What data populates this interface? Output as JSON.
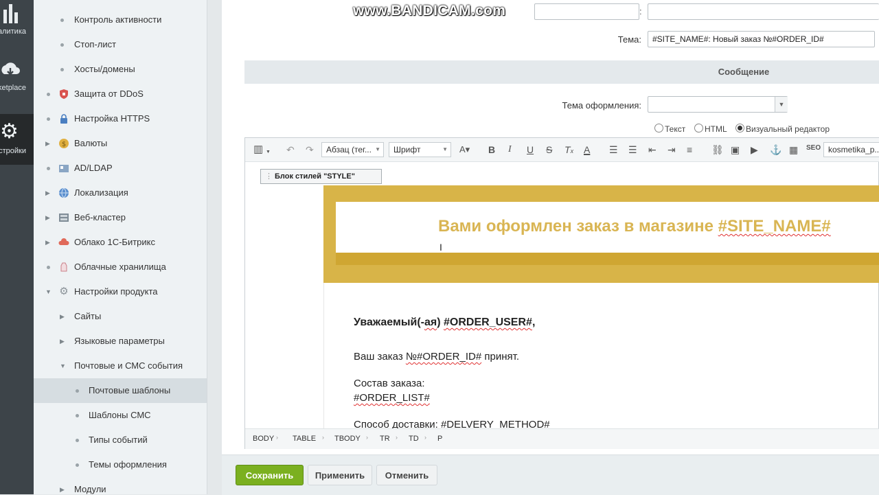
{
  "watermark": "www.BANDICAM.com",
  "rail": {
    "items": [
      {
        "icon": "analytics-icon",
        "label": "алитика"
      },
      {
        "icon": "marketplace-icon",
        "label": "ketplace"
      },
      {
        "icon": "settings-icon",
        "label": "стройки"
      }
    ]
  },
  "menu": {
    "items": [
      {
        "label": "Контроль активности",
        "level": 2
      },
      {
        "label": "Стоп-лист",
        "level": 2
      },
      {
        "label": "Хосты/домены",
        "level": 2
      },
      {
        "label": "Защита от DDoS",
        "level": 1,
        "icon": "ddos-shield-icon"
      },
      {
        "label": "Настройка HTTPS",
        "level": 1,
        "icon": "https-lock-icon"
      },
      {
        "label": "Валюты",
        "level": 1,
        "icon": "currency-icon"
      },
      {
        "label": "AD/LDAP",
        "level": 1,
        "icon": "ldap-icon"
      },
      {
        "label": "Локализация",
        "level": 1,
        "icon": "globe-icon"
      },
      {
        "label": "Веб-кластер",
        "level": 1,
        "icon": "cluster-icon"
      },
      {
        "label": "Облако 1С-Битрикс",
        "level": 1,
        "icon": "cloud-icon"
      },
      {
        "label": "Облачные хранилища",
        "level": 1,
        "icon": "storage-icon"
      },
      {
        "label": "Настройки продукта",
        "level": 1,
        "icon": "gear-icon"
      },
      {
        "label": "Сайты",
        "level": 2
      },
      {
        "label": "Языковые параметры",
        "level": 2
      },
      {
        "label": "Почтовые и СМС события",
        "level": 2
      },
      {
        "label": "Почтовые шаблоны",
        "level": 3
      },
      {
        "label": "Шаблоны СМС",
        "level": 3
      },
      {
        "label": "Типы событий",
        "level": 3
      },
      {
        "label": "Темы оформления",
        "level": 3
      },
      {
        "label": "Модули",
        "level": 2
      }
    ]
  },
  "form": {
    "colon": ":",
    "subject_label": "Тема:",
    "subject_value": "#SITE_NAME#: Новый заказ №#ORDER_ID#",
    "message_header": "Сообщение",
    "theme_label": "Тема оформления:",
    "theme_value": "",
    "formats": [
      "Текст",
      "HTML",
      "Визуальный редактор"
    ],
    "format_selected": "Визуальный редактор"
  },
  "toolbar": {
    "paragraph": "Абзац (тег...",
    "font": "Шрифт",
    "template": "kosmetika_p..."
  },
  "editor": {
    "style_block": "Блок стилей \"STYLE\"",
    "heading": "Вами оформлен заказ в магазине #SITE_NAME#",
    "heading_plain": "Вами оформлен заказ в магазине ",
    "heading_var": "#SITE_NAME#",
    "greet_a": "Уважаемый(-",
    "greet_b": "ая",
    "greet_c": ") ",
    "greet_d": "#ORDER_USER#",
    "greet_e": ",",
    "line1_a": "Ваш заказ ",
    "line1_b": "№#ORDER_ID#",
    "line1_c": " принят.",
    "line2": "Состав заказа:",
    "line3": "#ORDER_LIST#",
    "line4_a": "Способ доставки: ",
    "line4_b": "#DELVERY_METHOD#"
  },
  "pathbar": [
    "BODY",
    "TABLE",
    "TBODY",
    "TR",
    "TD",
    "P"
  ],
  "buttons": {
    "save": "Сохранить",
    "apply": "Применить",
    "cancel": "Отменить"
  }
}
